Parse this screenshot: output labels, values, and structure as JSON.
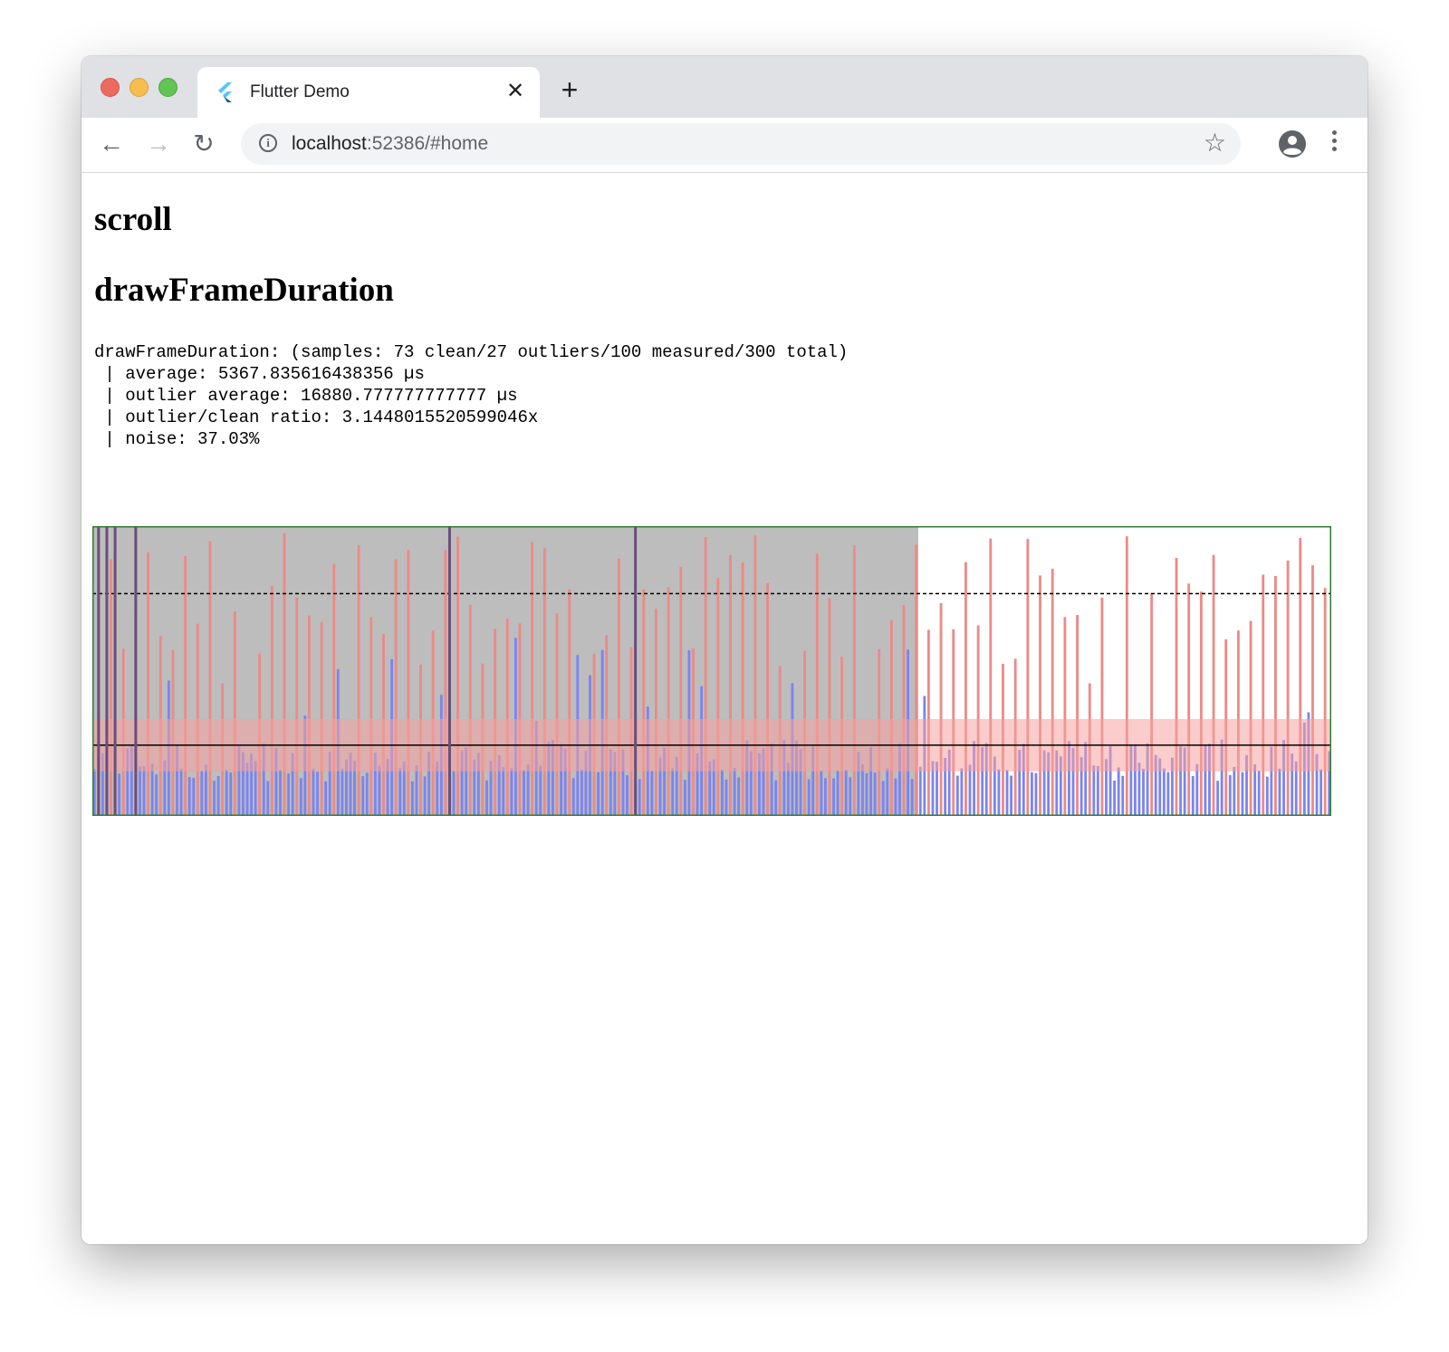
{
  "browser": {
    "tab_title": "Flutter Demo",
    "tab_close_glyph": "✕",
    "new_tab_glyph": "+",
    "url_host": "localhost",
    "url_rest": ":52386/#home",
    "icons": {
      "back": "←",
      "forward": "→",
      "reload": "↻",
      "info": "i",
      "bookmark": "☆"
    }
  },
  "page": {
    "title": "scroll",
    "metric_heading": "drawFrameDuration",
    "stats_lines": [
      "drawFrameDuration: (samples: 73 clean/27 outliers/100 measured/300 total)",
      " | average: 5367.835616438356 µs",
      " | outlier average: 16880.777777777777 µs",
      " | outlier/clean ratio: 3.1448015520599046x",
      " | noise: 37.03%"
    ]
  },
  "chart_data": {
    "type": "bar",
    "sample_count": 300,
    "warmup_count": 200,
    "average": 5367.835616438356,
    "outlier_average": 16880.777777777777,
    "noise_fraction": 0.3703,
    "colors": {
      "clean": "#7b84ef",
      "outlier": "#ec8a86",
      "warmup_band": "#bdbdbd",
      "noise_band": "#f5a3a0",
      "border": "#2e7d32",
      "marker": "#6b4d7a"
    },
    "warmup_markers": [
      1,
      3,
      5,
      10,
      86,
      131
    ]
  }
}
